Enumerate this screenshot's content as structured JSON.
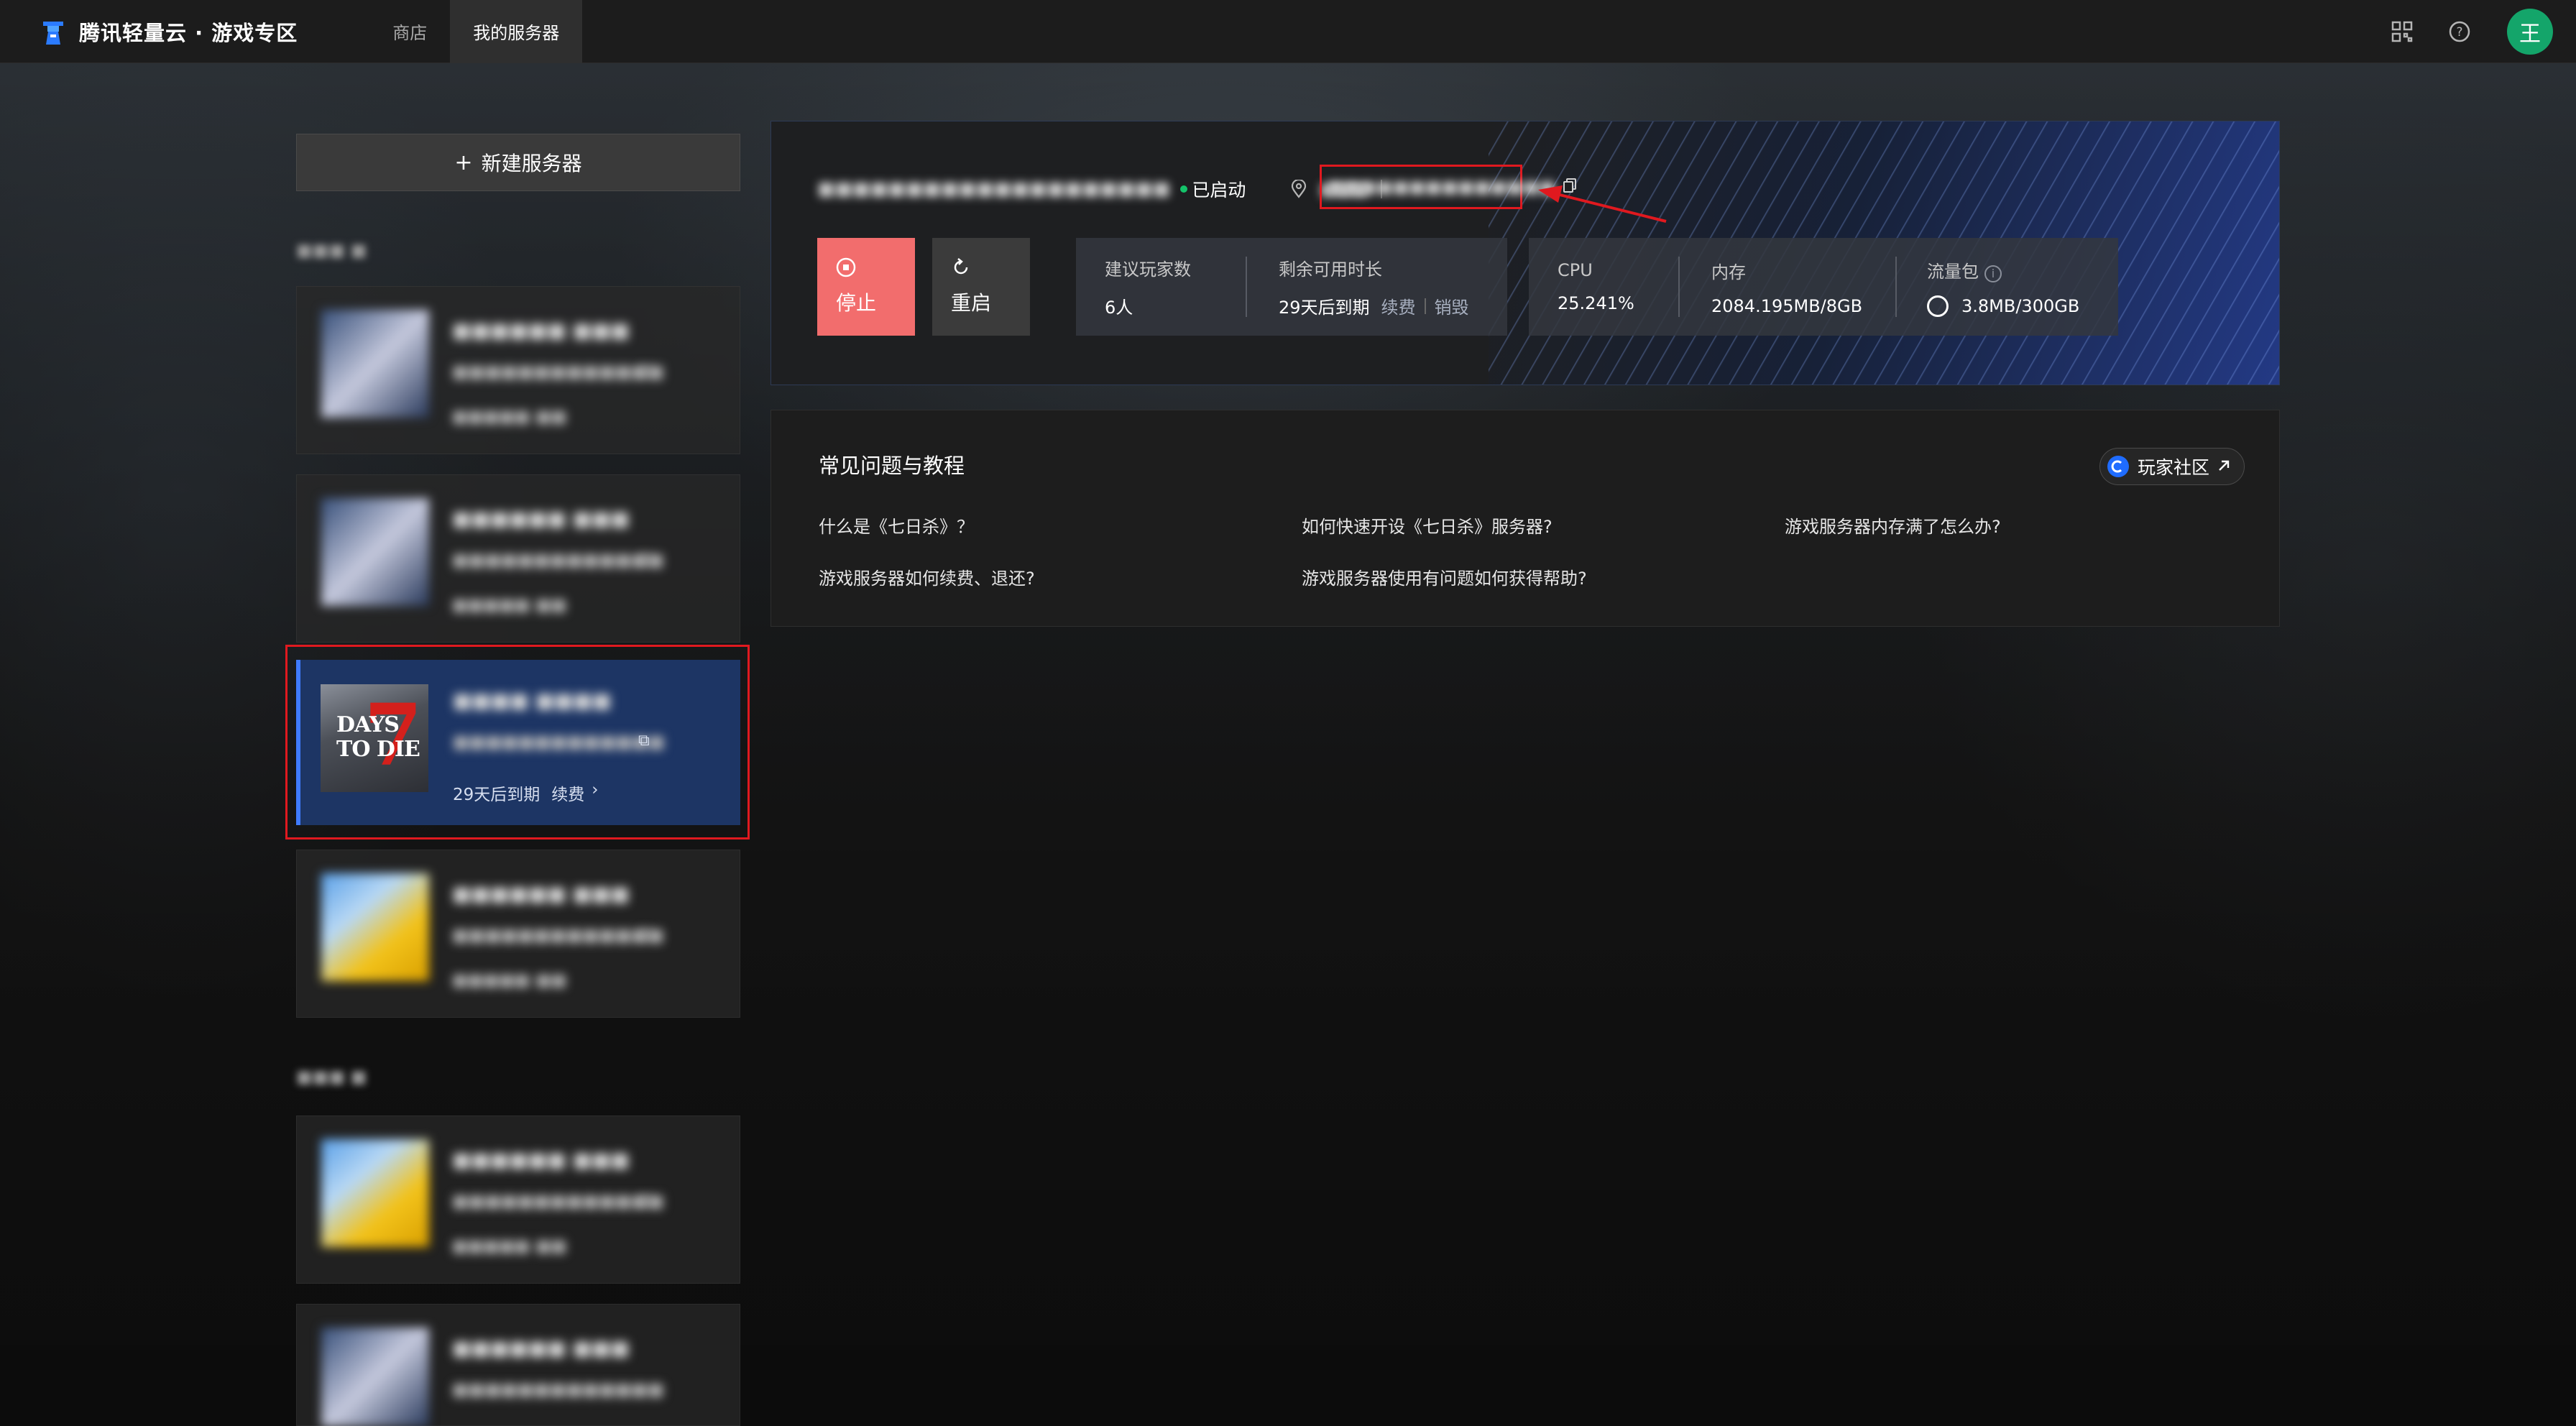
{
  "topbar": {
    "brand": "腾讯轻量云 · 游戏专区",
    "nav": [
      "商店",
      "我的服务器"
    ],
    "avatar_text": "王"
  },
  "sidebar": {
    "new_server_label": "新建服务器",
    "selected_server": {
      "thumb_title": "DAYS TO DIE",
      "thumb_number": "7",
      "expiry": "29天后到期",
      "renew": "续费",
      "renew_chevron": "›"
    }
  },
  "server": {
    "status": "已启动",
    "actions": {
      "stop": "停止",
      "restart": "重启"
    },
    "stats": {
      "players_label": "建议玩家数",
      "players_value": "6人",
      "remaining_label": "剩余可用时长",
      "remaining_value": "29天后到期",
      "renew_link": "续费",
      "destroy_link": "销毁",
      "cpu_label": "CPU",
      "cpu_value": "25.241%",
      "memory_label": "内存",
      "memory_value": "2084.195MB/8GB",
      "traffic_label": "流量包",
      "traffic_value": "3.8MB/300GB"
    }
  },
  "faq": {
    "title": "常见问题与教程",
    "community_label": "玩家社区",
    "items": [
      "什么是《七日杀》？",
      "如何快速开设《七日杀》服务器?",
      "游戏服务器内存满了怎么办?",
      "游戏服务器如何续费、退还?",
      "游戏服务器使用有问题如何获得帮助?"
    ]
  },
  "colors": {
    "accent_blue": "#3f7bff",
    "stop_button": "#f26d6d",
    "status_green": "#14c36a",
    "annotation_red": "#e0191f",
    "avatar_green": "#14a56a"
  }
}
